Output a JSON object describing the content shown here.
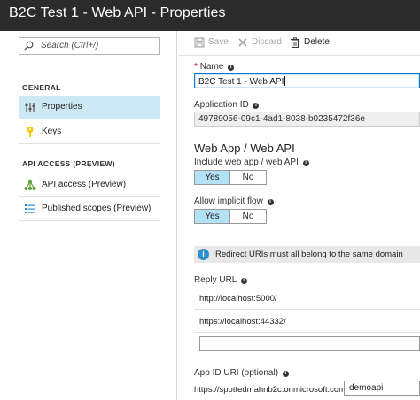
{
  "window": {
    "title": "B2C Test 1 - Web API - Properties"
  },
  "sidebar": {
    "search_placeholder": "Search (Ctrl+/)",
    "general_heading": "GENERAL",
    "api_heading": "API ACCESS (PREVIEW)",
    "items": [
      {
        "label": "Properties",
        "icon": "properties-icon",
        "active": true
      },
      {
        "label": "Keys",
        "icon": "key-icon",
        "active": false
      },
      {
        "label": "API access (Preview)",
        "icon": "api-access-icon",
        "active": false
      },
      {
        "label": "Published scopes (Preview)",
        "icon": "scopes-list-icon",
        "active": false
      }
    ]
  },
  "toolbar": {
    "save_label": "Save",
    "discard_label": "Discard",
    "delete_label": "Delete"
  },
  "form": {
    "name_label": "Name",
    "name_value": "B2C Test 1 - Web API",
    "appid_label": "Application ID",
    "appid_value": "49789056-09c1-4ad1-8038-b0235472f36e",
    "webapp_heading": "Web App / Web API",
    "include_label": "Include web app / web API",
    "implicit_label": "Allow implicit flow",
    "yes_label": "Yes",
    "no_label": "No",
    "include_selected": "Yes",
    "implicit_selected": "Yes",
    "info_message": "Redirect URIs must all belong to the same domain",
    "reply_label": "Reply URL",
    "reply_urls": [
      "http://localhost:5000/",
      "https://localhost:44332/"
    ],
    "appid_uri_label": "App ID URI (optional)",
    "appid_uri_prefix": "https://spottedmahnb2c.onmicrosoft.com/",
    "appid_uri_value": "demoapi"
  },
  "colors": {
    "titlebar": "#2b2b2b",
    "active_nav": "#cce8f4",
    "toggle_on": "#b3e1f5",
    "info_icon": "#2b8fcf"
  }
}
